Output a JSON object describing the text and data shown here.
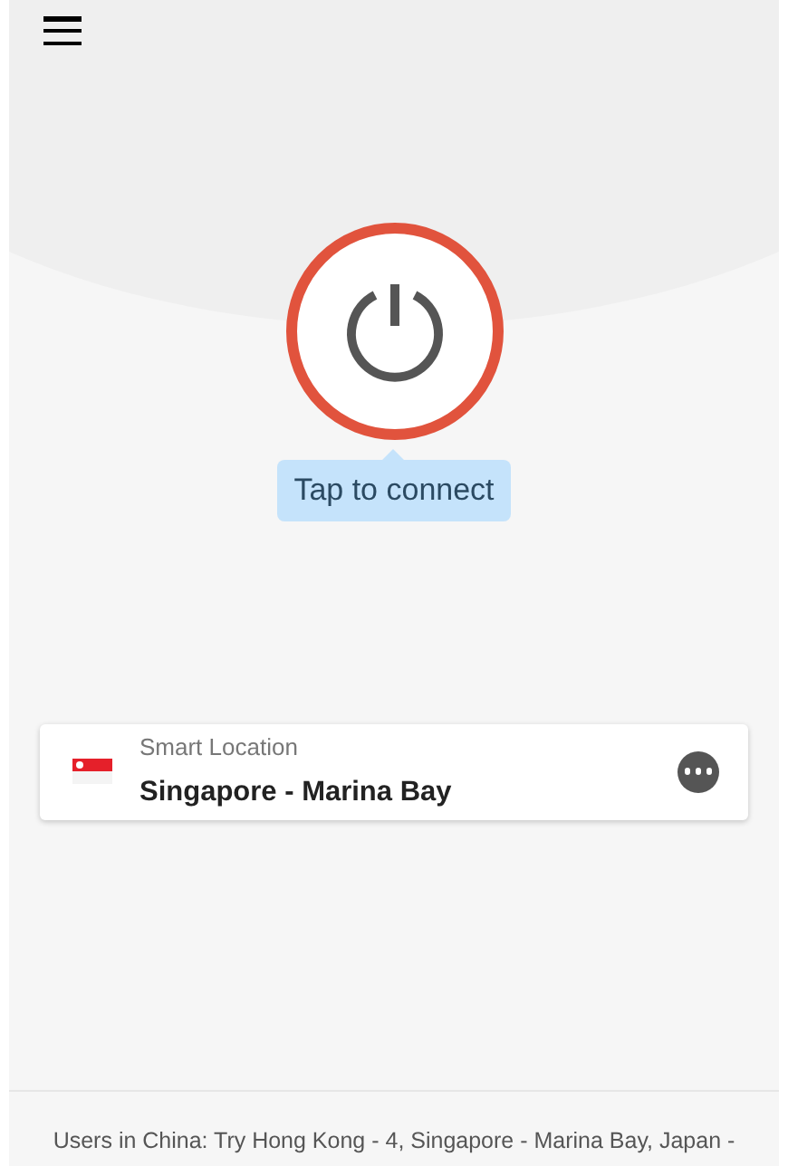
{
  "connect_hint": "Tap to connect",
  "location": {
    "label": "Smart Location",
    "name": "Singapore - Marina Bay"
  },
  "footer": "Users in China: Try Hong Kong - 4, Singapore - Marina Bay, Japan -"
}
